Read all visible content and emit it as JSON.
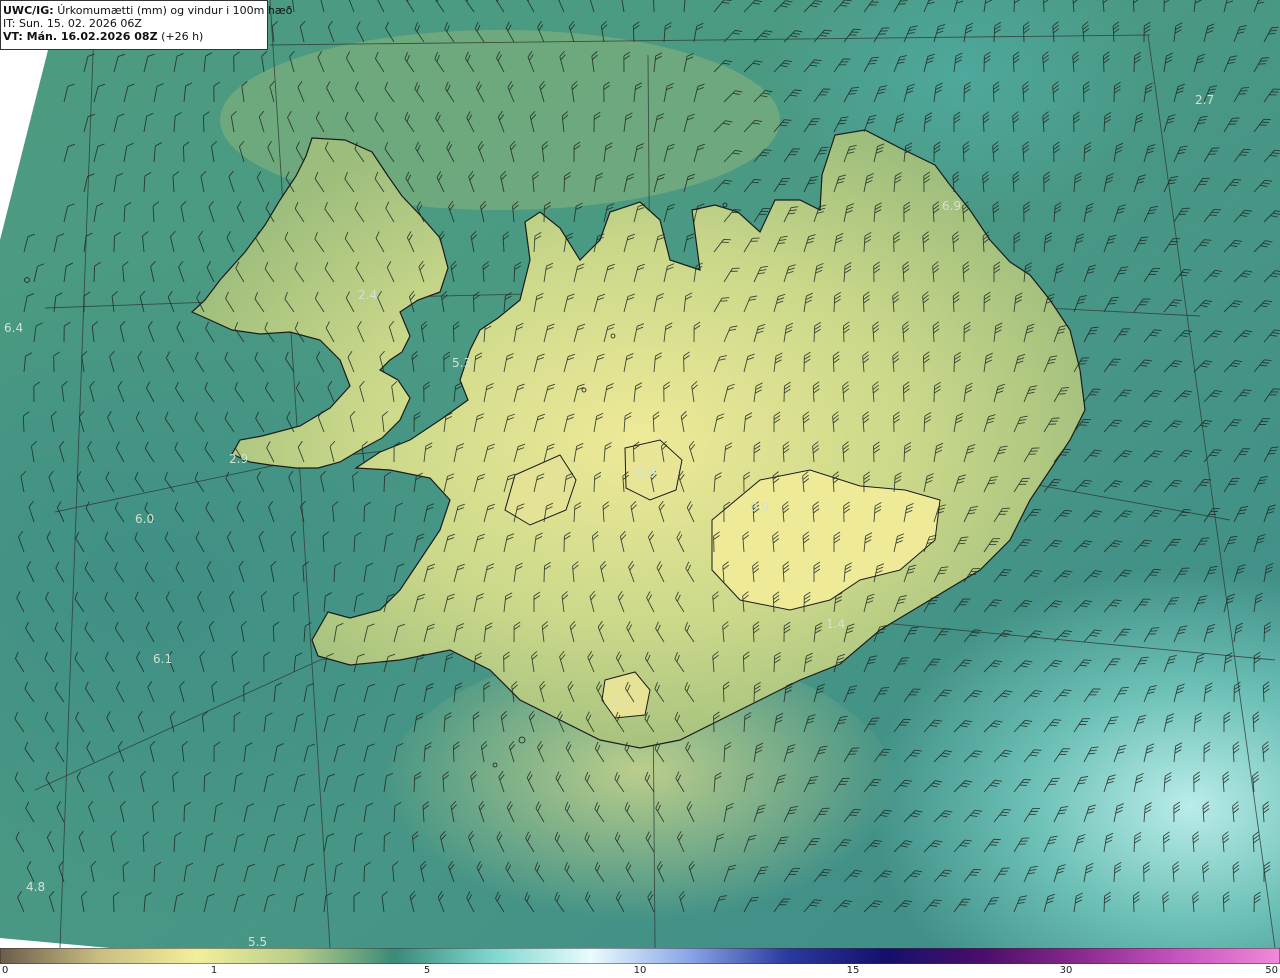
{
  "header": {
    "model": "UWC/IG:",
    "title": "Úrkomumætti (mm) og vindur i 100m hæð",
    "issue_time": "IT: Sun. 15. 02. 2026 06Z",
    "valid_prefix": "VT: Mán. 16.02.2026 08Z",
    "valid_offset": "(+26 h)"
  },
  "value_labels": [
    {
      "id": "v1",
      "text": "2.4"
    },
    {
      "id": "v2",
      "text": "6.4"
    },
    {
      "id": "v3",
      "text": "5.3"
    },
    {
      "id": "v4",
      "text": "2.9"
    },
    {
      "id": "v5",
      "text": "6.0"
    },
    {
      "id": "v6",
      "text": "6.1"
    },
    {
      "id": "v7",
      "text": "4.8"
    },
    {
      "id": "v8",
      "text": "5.5"
    },
    {
      "id": "v9",
      "text": "6.9"
    },
    {
      "id": "v10",
      "text": "2.7"
    },
    {
      "id": "v11",
      "text": "0.9"
    },
    {
      "id": "v12",
      "text": "0.9"
    },
    {
      "id": "v13",
      "text": "1.4"
    },
    {
      "id": "v14",
      "text": "2.1"
    }
  ],
  "colorbar": {
    "ticks": [
      "0",
      "1",
      "5",
      "10",
      "15",
      "30",
      "50"
    ],
    "colors": [
      "#6b5c4a",
      "#c9bd82",
      "#f3ee9c",
      "#b7cd8a",
      "#3b8a78",
      "#7fd7d0",
      "#e9fbfd",
      "#8aa6e6",
      "#2b3a9e",
      "#14106b",
      "#4a0f6a",
      "#8b2b8f",
      "#c756c0",
      "#f08ad8"
    ]
  },
  "colors": {
    "sea": "#3f8f7a",
    "land_dry": "#e9e493",
    "land_mid": "#a8c47f",
    "coastline": "#1c1c1c"
  }
}
